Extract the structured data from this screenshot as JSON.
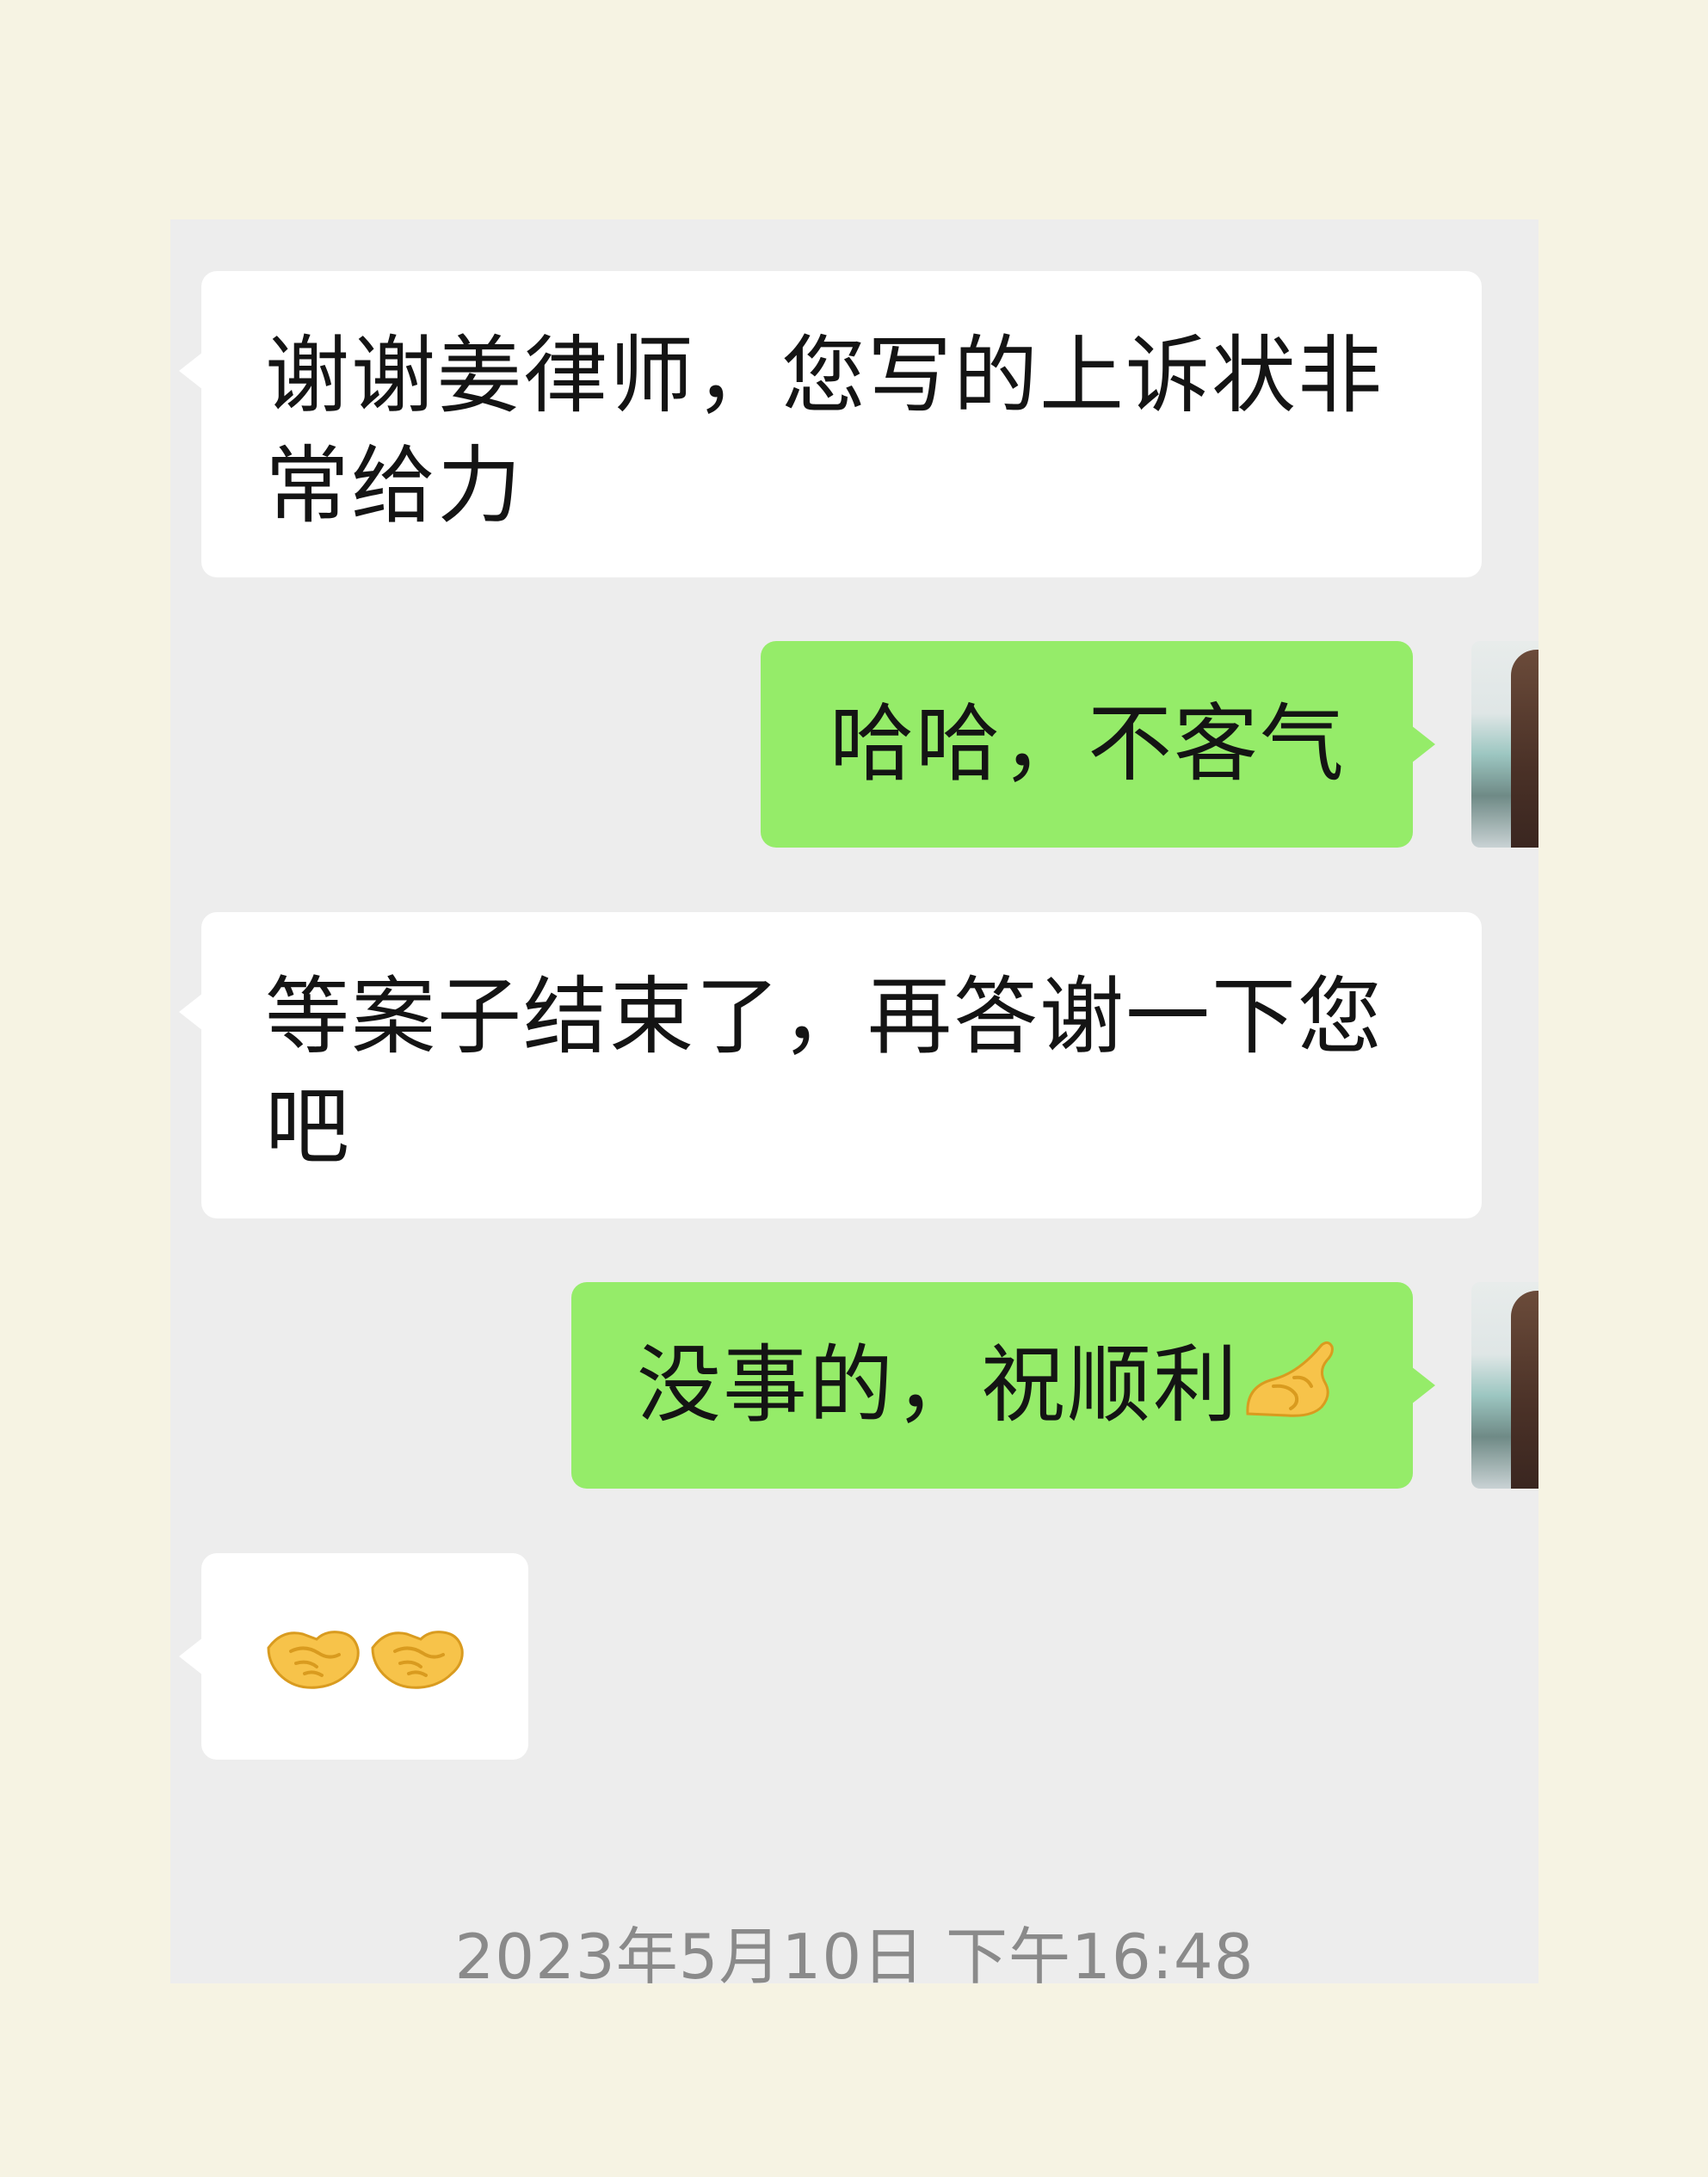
{
  "messages": [
    {
      "side": "received",
      "text": "谢谢姜律师，您写的上诉状非常给力"
    },
    {
      "side": "sent",
      "text": "哈哈，不客气"
    },
    {
      "side": "received",
      "text": "等案子结束了，再答谢一下您吧"
    },
    {
      "side": "sent",
      "text": "没事的，祝顺利",
      "emoji": "pinched-fingers-emoji"
    },
    {
      "side": "received",
      "text": "",
      "emoji": "handshake-emoji x2"
    }
  ],
  "timestamp": "2023年5月10日 下午16:48",
  "colors": {
    "page_background": "#f6f3e3",
    "chat_background": "#ededed",
    "received_bubble": "#ffffff",
    "sent_bubble": "#95ec69",
    "timestamp_text": "#8a8a8a"
  }
}
